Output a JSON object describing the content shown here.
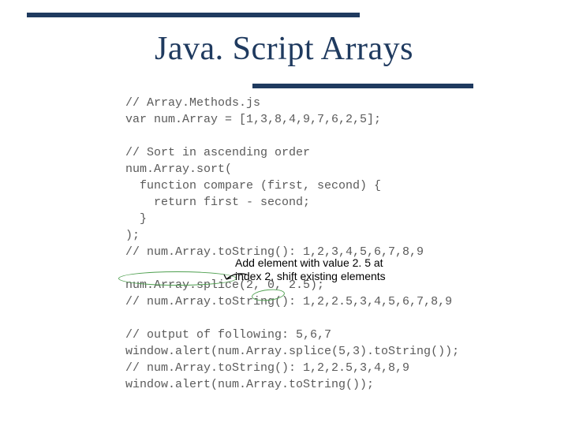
{
  "title": "Java. Script Arrays",
  "code": "// Array.Methods.js\nvar num.Array = [1,3,8,4,9,7,6,2,5];\n\n// Sort in ascending order\nnum.Array.sort(\n  function compare (first, second) {\n    return first - second;\n  }\n);\n// num.Array.toString(): 1,2,3,4,5,6,7,8,9\n\nnum.Array.splice(2, 0, 2.5);\n// num.Array.toString(): 1,2,2.5,3,4,5,6,7,8,9\n\n// output of following: 5,6,7\nwindow.alert(num.Array.splice(5,3).toString());\n// num.Array.toString(): 1,2,2.5,3,4,8,9\nwindow.alert(num.Array.toString());",
  "annotation": {
    "line1": "Add element with value 2. 5 at",
    "line2": "index 2, shift existing elements"
  }
}
